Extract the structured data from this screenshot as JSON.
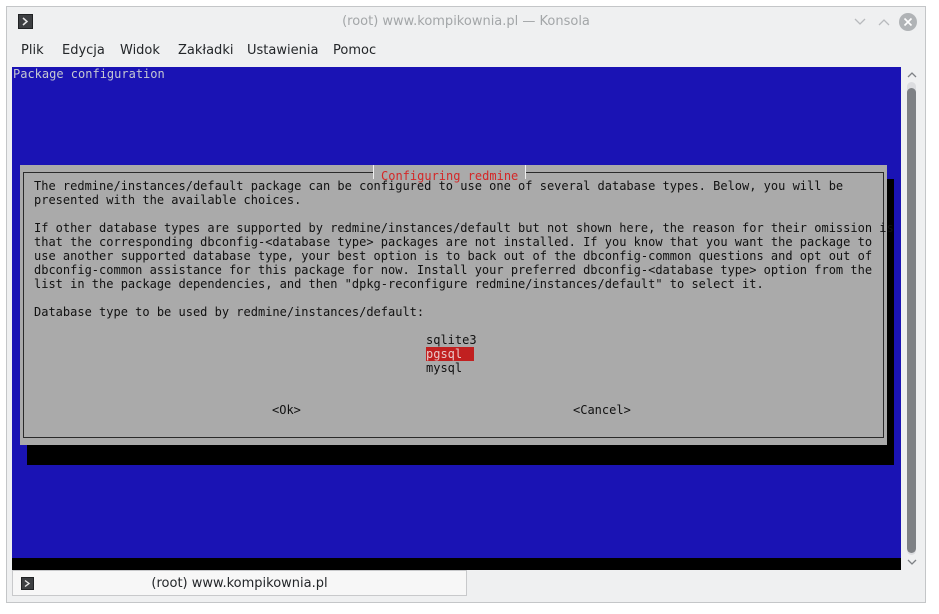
{
  "window": {
    "title": "(root) www.kompikownia.pl — Konsola"
  },
  "menubar": {
    "items": [
      "Plik",
      "Edycja",
      "Widok",
      "Zakładki",
      "Ustawienia",
      "Pomoc"
    ]
  },
  "terminal": {
    "header": "Package configuration",
    "dialog": {
      "title": "Configuring redmine",
      "paragraphs": [
        "The redmine/instances/default package can be configured to use one of several database types. Below, you will be",
        "presented with the available choices.",
        "If other database types are supported by redmine/instances/default but not shown here, the reason for their omission is",
        "that the corresponding dbconfig-<database type> packages are not installed. If you know that you want the package to",
        "use another supported database type, your best option is to back out of the dbconfig-common questions and opt out of",
        "dbconfig-common assistance for this package for now. Install your preferred dbconfig-<database type> option from the",
        "list in the package dependencies, and then \"dpkg-reconfigure redmine/instances/default\" to select it.",
        "Database type to be used by redmine/instances/default:"
      ],
      "options": [
        "sqlite3",
        "pgsql",
        "mysql"
      ],
      "selected_option": "pgsql",
      "ok_label": "<Ok>",
      "cancel_label": "<Cancel>"
    }
  },
  "tabs": [
    {
      "label": "(root) www.kompikownia.pl"
    }
  ],
  "colors": {
    "terminal_bg": "#1a13b4",
    "dialog_bg": "#aaaaaa",
    "dialog_title": "#d42727",
    "selection_bg": "#c12020"
  }
}
